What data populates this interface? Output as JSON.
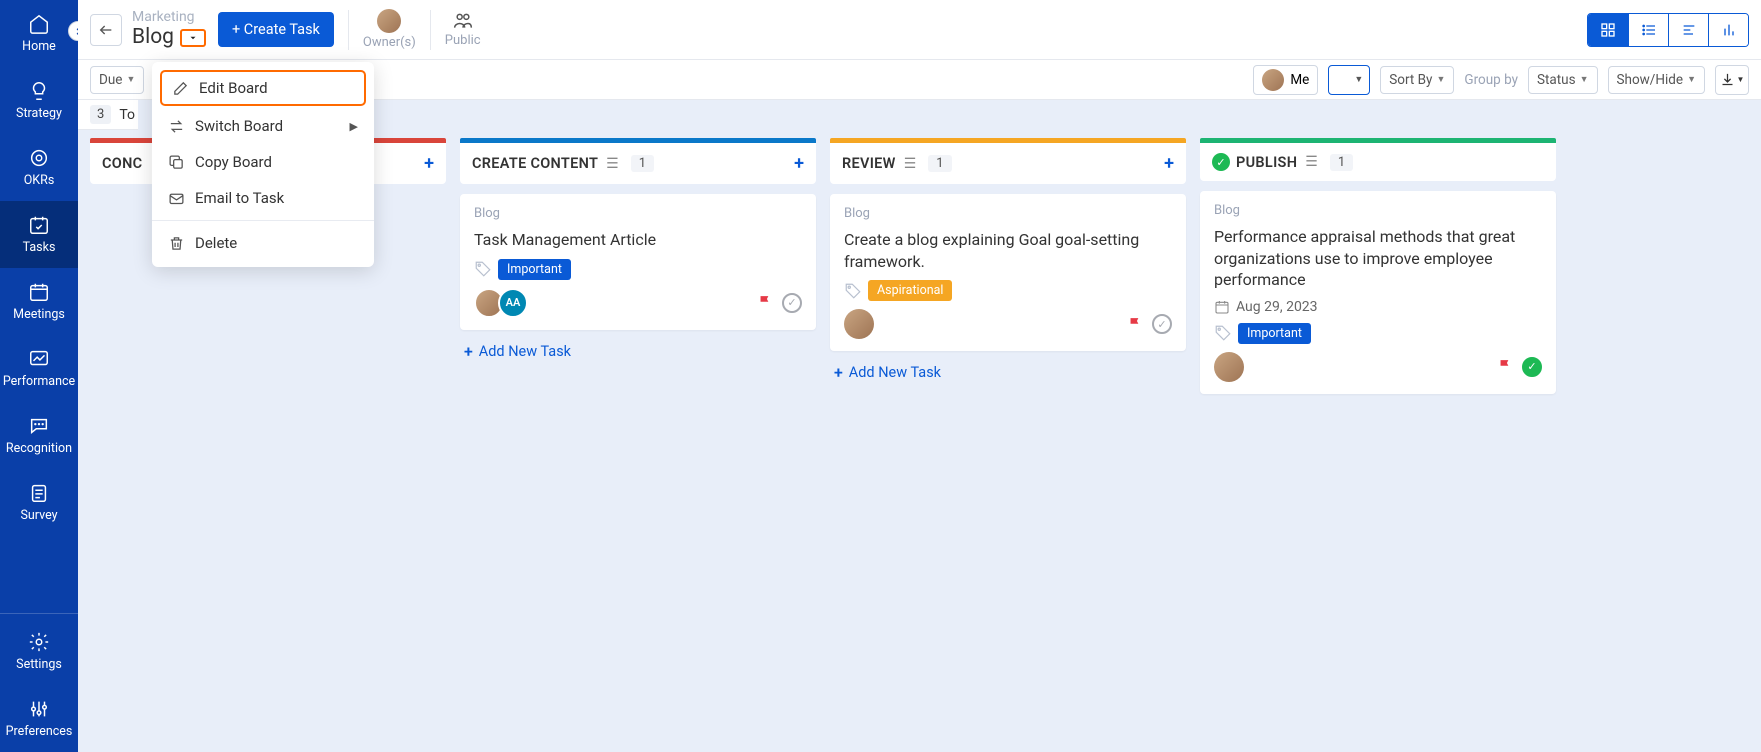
{
  "sidebar": {
    "items": [
      {
        "label": "Home"
      },
      {
        "label": "Strategy"
      },
      {
        "label": "OKRs"
      },
      {
        "label": "Tasks"
      },
      {
        "label": "Meetings"
      },
      {
        "label": "Performance"
      },
      {
        "label": "Recognition"
      },
      {
        "label": "Survey"
      }
    ],
    "bottom": [
      {
        "label": "Settings"
      },
      {
        "label": "Preferences"
      }
    ]
  },
  "header": {
    "parent": "Marketing",
    "title": "Blog",
    "createTask": "+ Create Task",
    "owners": "Owner(s)",
    "public": "Public"
  },
  "filters": {
    "due": "Due",
    "me": "Me",
    "sortBy": "Sort By",
    "groupBy": "Group by",
    "status": "Status",
    "showHide": "Show/Hide"
  },
  "countbar": {
    "count": "3",
    "label": "To"
  },
  "menu": {
    "editBoard": "Edit Board",
    "switchBoard": "Switch Board",
    "copyBoard": "Copy Board",
    "emailToTask": "Email to Task",
    "delete": "Delete"
  },
  "columns": [
    {
      "title": "CONC",
      "count": "",
      "color": "#d9453b"
    },
    {
      "title": "CREATE CONTENT",
      "count": "1",
      "color": "#0a78c9"
    },
    {
      "title": "REVIEW",
      "count": "1",
      "color": "#f5a623"
    },
    {
      "title": "PUBLISH",
      "count": "1",
      "color": "#1db473"
    }
  ],
  "cards": {
    "createContent": {
      "category": "Blog",
      "title": "Task Management Article",
      "tag": "Important"
    },
    "review": {
      "category": "Blog",
      "title": "Create a blog explaining Goal goal-setting framework.",
      "tag": "Aspirational"
    },
    "publish": {
      "category": "Blog",
      "title": "Performance appraisal methods that great organizations use to improve employee performance",
      "date": "Aug 29, 2023",
      "tag": "Important"
    }
  },
  "addNewTask": "Add New Task",
  "aaInitials": "AA"
}
